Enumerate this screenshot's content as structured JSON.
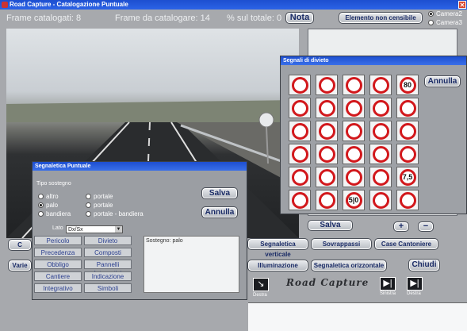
{
  "window": {
    "title": "Road Capture - Catalogazione Puntuale",
    "close_glyph": "✕"
  },
  "info": {
    "frame_catalogati": "Frame catalogati: 8",
    "frame_da_catalogare": "Frame da catalogare: 14",
    "percentuale": "% sul totale: 0"
  },
  "top_buttons": {
    "nota": "Nota",
    "elemento_non_censibile": "Elemento non censibile"
  },
  "cameras": [
    "Camera2",
    "Camera3"
  ],
  "signs_window": {
    "title": "Segnali di divieto",
    "annulla": "Annulla",
    "signs": [
      "no-entry-empty",
      "no-entry",
      "no-overtaking",
      "no-overtaking-trucks",
      "80",
      "no-trucks",
      "no-goods",
      "no-motorcycle",
      "no-pedestrian",
      "no-bicycle",
      "no-bicycle-2",
      "no-motor-vehicles",
      "no-buses",
      "no-vehicles-width",
      "no-trucks-2",
      "no-cars",
      "no-towing",
      "no-tractors",
      "no-hazmat",
      "no-hazmat-2",
      "no-left",
      "no-right",
      "no-u-turn",
      "no-horn",
      "7.5t",
      "no-stopping",
      "end-restriction",
      "5.0",
      "end-no-overtaking",
      "end-all"
    ],
    "sign_text": {
      "s4": "80",
      "s24": "7,5",
      "s27": "5|0"
    }
  },
  "seg_window": {
    "title": "Segnaletica Puntuale",
    "tipo_sostegno": "Tipo sostegno",
    "radios": [
      {
        "label": "altro",
        "checked": false
      },
      {
        "label": "palo",
        "checked": true
      },
      {
        "label": "bandiera",
        "checked": false
      },
      {
        "label": "portale",
        "checked": false
      },
      {
        "label": "portale",
        "checked": false
      },
      {
        "label": "portale - bandiera",
        "checked": false
      }
    ],
    "salva": "Salva",
    "annulla": "Annulla",
    "lato_label": "Lato",
    "lato_value": "Dx/Sx",
    "sostegno_note": "Sostegno: palo",
    "buttons": [
      "Pericolo",
      "Divieto",
      "Precedenza",
      "Composti",
      "Obbligo",
      "Pannelli Integrativi",
      "Cantiere",
      "Indicazione",
      "Integrativo",
      "Simboli"
    ]
  },
  "bottom": {
    "salva": "Salva",
    "plus": "+",
    "minus": "−",
    "verticale": "Segnaletica verticale",
    "sovrappassi": "Sovrappassi",
    "case_cantoniere": "Case Cantoniere",
    "illuminazione": "Illuminazione",
    "orizzontale": "Segnaletica orizzontale",
    "chiudi": "Chiudi",
    "left_partial_1": "C",
    "left_partial_2": "Varie",
    "logo": "Road Capture",
    "destra_1": "Destra",
    "sinistra": "Sinistra",
    "destra_2": "Destra"
  }
}
